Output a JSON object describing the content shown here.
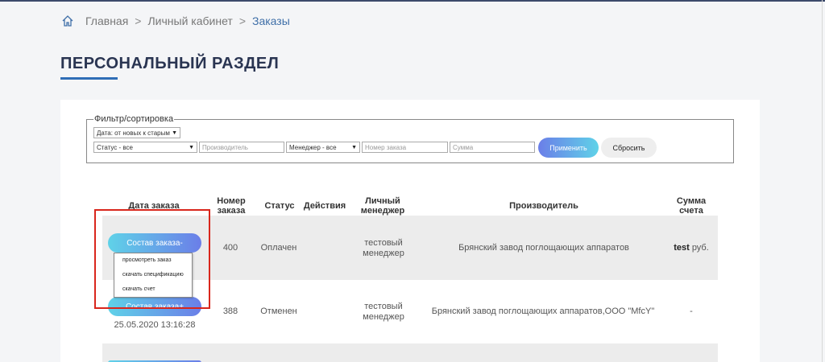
{
  "breadcrumb": {
    "home": "Главная",
    "sep1": ">",
    "cabinet": "Личный кабинет",
    "sep2": ">",
    "orders": "Заказы"
  },
  "page_title": "ПЕРСОНАЛЬНЫЙ РАЗДЕЛ",
  "filter": {
    "legend": "Фильтр/сортировка",
    "sort_value": "Дата: от новых к старым",
    "status_value": "Статус - все",
    "producer_placeholder": "Производитель",
    "manager_value": "Менеджер - все",
    "order_number_placeholder": "Номер заказа",
    "sum_placeholder": "Сумма",
    "apply_label": "Применить",
    "reset_label": "Сбросить"
  },
  "table": {
    "headers": {
      "date": "Дата заказа",
      "number_l1": "Номер",
      "number_l2": "заказа",
      "status": "Статус",
      "actions": "Действия",
      "manager_l1": "Личный",
      "manager_l2": "менеджер",
      "producer": "Производитель",
      "sum_l1": "Сумма",
      "sum_l2": "счета"
    },
    "rows": [
      {
        "button": "Состав заказа-",
        "number": "400",
        "status": "Оплачен",
        "manager_l1": "тестовый",
        "manager_l2": "менеджер",
        "producer": "Брянский завод поглощающих аппаратов",
        "sum_bold": "test",
        "sum_unit": "руб."
      },
      {
        "button": "Состав заказа+",
        "date": "25.05.2020 13:16:28",
        "number": "388",
        "status": "Отменен",
        "manager_l1": "тестовый",
        "manager_l2": "менеджер",
        "producer": "Брянский завод поглощающих аппаратов,ООО \"MfcY\"",
        "sum": "-"
      }
    ]
  },
  "dropdown": {
    "items": [
      "просмотреть заказ",
      "скачать спецификацию",
      "скачать счет"
    ]
  },
  "colors": {
    "accent": "#2f6db6",
    "title": "#2a3552",
    "highlight": "#d9261c"
  },
  "icons": {
    "home": "home-icon",
    "select_arrow": "triangle-down-icon"
  }
}
